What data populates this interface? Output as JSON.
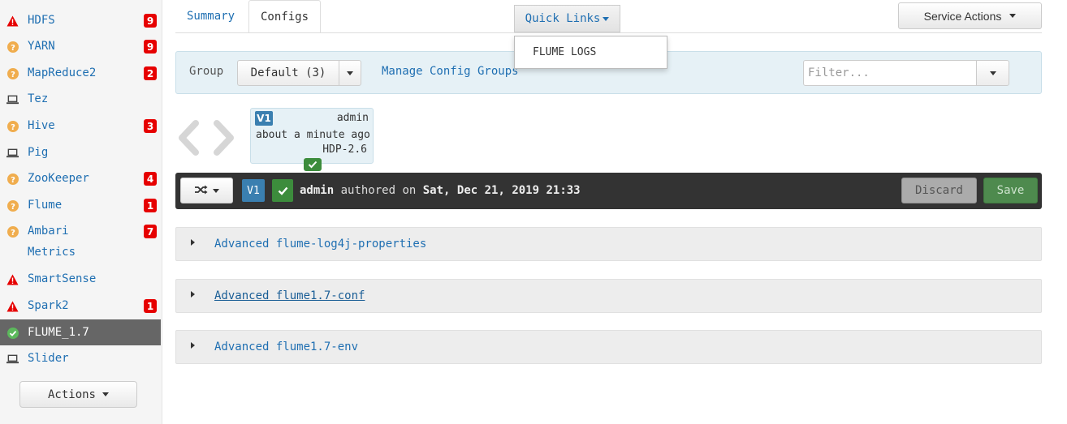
{
  "sidebar": {
    "services": [
      {
        "name": "HDFS",
        "status": "critical",
        "alerts": "9"
      },
      {
        "name": "YARN",
        "status": "unknown",
        "alerts": "9"
      },
      {
        "name": "MapReduce2",
        "status": "unknown",
        "alerts": "2"
      },
      {
        "name": "Tez",
        "status": "client",
        "alerts": ""
      },
      {
        "name": "Hive",
        "status": "unknown",
        "alerts": "3"
      },
      {
        "name": "Pig",
        "status": "client",
        "alerts": ""
      },
      {
        "name": "ZooKeeper",
        "status": "unknown",
        "alerts": "4"
      },
      {
        "name": "Flume",
        "status": "unknown",
        "alerts": "1"
      },
      {
        "name_line1": "Ambari",
        "name_line2": "Metrics",
        "status": "unknown",
        "alerts": "7"
      },
      {
        "name": "SmartSense",
        "status": "critical",
        "alerts": ""
      },
      {
        "name": "Spark2",
        "status": "critical",
        "alerts": "1"
      },
      {
        "name": "FLUME_1.7",
        "status": "ok",
        "alerts": "",
        "active": true
      },
      {
        "name": "Slider",
        "status": "client",
        "alerts": ""
      }
    ],
    "actions_label": "Actions"
  },
  "tabs": {
    "summary": "Summary",
    "configs": "Configs"
  },
  "quick_links": {
    "label": "Quick Links",
    "menu": [
      "FLUME LOGS"
    ]
  },
  "service_actions_label": "Service Actions",
  "group_bar": {
    "label": "Group",
    "selected": "Default (3)",
    "manage_link": "Manage Config Groups",
    "filter_placeholder": "Filter..."
  },
  "version_card": {
    "version": "V1",
    "author": "admin",
    "time": "about a minute ago",
    "stack": "HDP-2.6"
  },
  "version_bar": {
    "version": "V1",
    "author": "admin",
    "authored_on_text": "authored on",
    "date": "Sat, Dec 21, 2019 21:33",
    "discard_label": "Discard",
    "save_label": "Save"
  },
  "sections": [
    "Advanced flume-log4j-properties",
    "Advanced flume1.7-conf",
    "Advanced flume1.7-env"
  ],
  "colors": {
    "link": "#1f6fb2",
    "critical": "#e60000",
    "warning": "#f0ad4e",
    "ok": "#5cb85c",
    "version_blue": "#3a7fb0",
    "save_green": "#4e8a4e"
  }
}
